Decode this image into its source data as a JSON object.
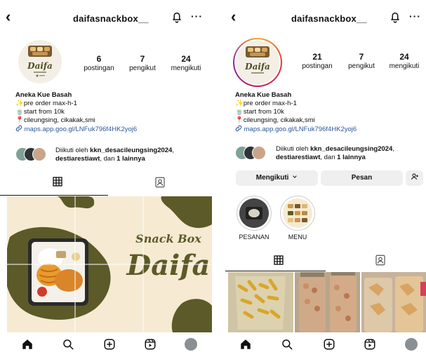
{
  "left": {
    "username": "daifasnackbox__",
    "stats": [
      {
        "num": "6",
        "label": "postingan"
      },
      {
        "num": "7",
        "label": "pengikut"
      },
      {
        "num": "24",
        "label": "mengikuti"
      }
    ],
    "bio": {
      "name": "Aneka Kue Basah",
      "lines": [
        "✨pre order max-h-1",
        "🍵start from 10k",
        "📍cileungsing, cikakak,smi"
      ],
      "link": "maps.app.goo.gl/LNFuk796f4HK2yoj6"
    },
    "followed_by": {
      "prefix": "Diikuti oleh ",
      "user1": "kkn_desacileungsing2024",
      "sep": ",",
      "user2": "destiarestiawt",
      "mid": ", dan ",
      "rest": "1 lainnya"
    },
    "post": {
      "line1": "Snack Box",
      "line2": "Daifa"
    }
  },
  "right": {
    "username": "daifasnackbox__",
    "stats": [
      {
        "num": "21",
        "label": "postingan"
      },
      {
        "num": "7",
        "label": "pengikut"
      },
      {
        "num": "24",
        "label": "mengikuti"
      }
    ],
    "bio": {
      "name": "Aneka Kue Basah",
      "lines": [
        "✨pre order max-h-1",
        "🍵start from 10k",
        "📍cileungsing, cikakak,smi"
      ],
      "link": "maps.app.goo.gl/LNFuk796f4HK2yoj6"
    },
    "followed_by": {
      "prefix": "Diikuti oleh ",
      "user1": "kkn_desacileungsing2024",
      "sep": ",",
      "user2": "destiarestiawt",
      "mid": ", dan ",
      "rest": "1 lainnya"
    },
    "buttons": {
      "following": "Mengikuti",
      "message": "Pesan"
    },
    "highlights": [
      {
        "label": "PESANAN"
      },
      {
        "label": "MENU"
      }
    ]
  },
  "avatar_text": "Daifa",
  "colors": {
    "accent_green": "#5c5a28",
    "cream": "#f6ead2",
    "link": "#2b5797"
  }
}
